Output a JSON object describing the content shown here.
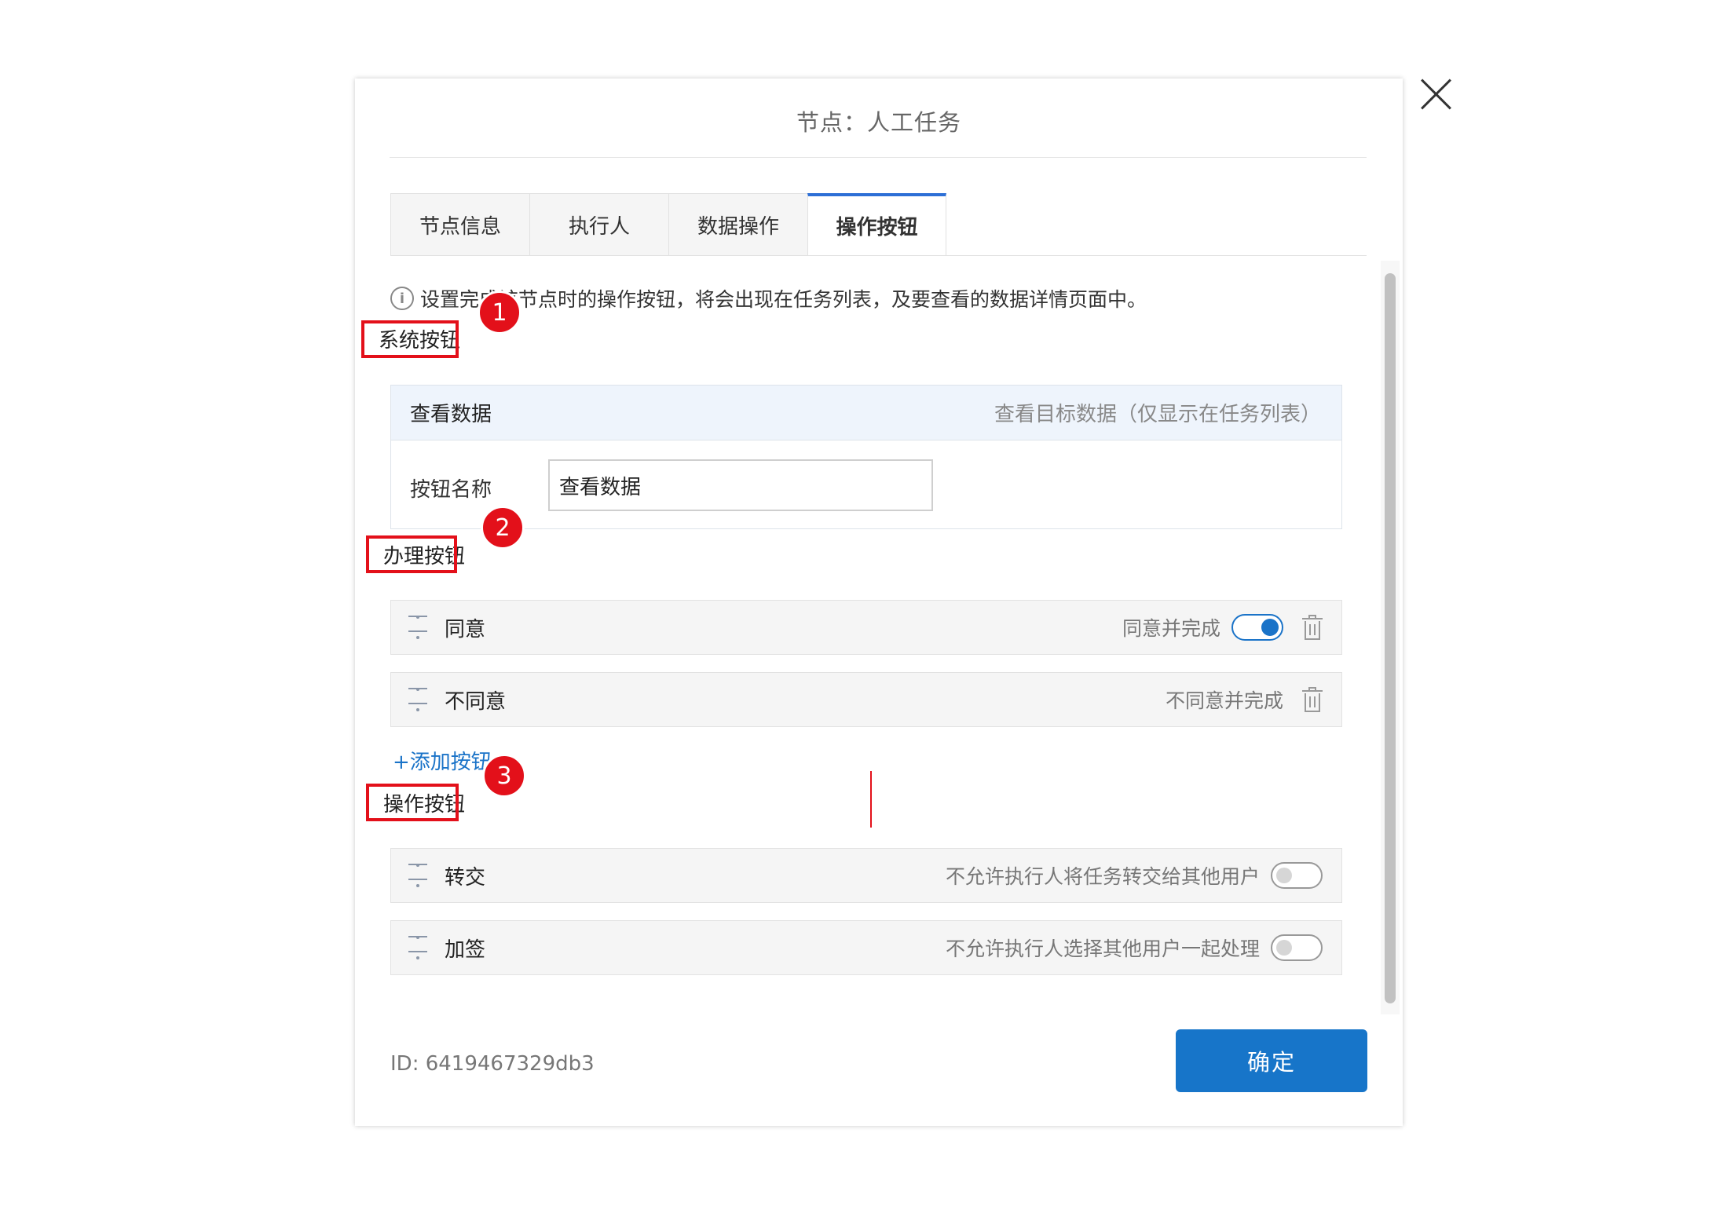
{
  "modal": {
    "title": "节点：人工任务",
    "tabs": [
      {
        "label": "节点信息"
      },
      {
        "label": "执行人"
      },
      {
        "label": "数据操作"
      },
      {
        "label": "操作按钮"
      }
    ],
    "active_tab": "操作按钮",
    "info_text": "设置完成该节点时的操作按钮，将会出现在任务列表，及要查看的数据详情页面中。",
    "info_icon": "info-circle-icon"
  },
  "annotations": [
    "1",
    "2",
    "3"
  ],
  "system_buttons": {
    "section_label": "系统按钮",
    "card": {
      "name": "查看数据",
      "description": "查看目标数据（仅显示在任务列表）",
      "field_label": "按钮名称",
      "field_value": "查看数据"
    }
  },
  "handle_buttons": {
    "section_label": "办理按钮",
    "rows": [
      {
        "name": "同意",
        "description": "同意并完成",
        "toggle": "on"
      },
      {
        "name": "不同意",
        "description": "不同意并完成"
      }
    ],
    "add_label": "+添加按钮"
  },
  "action_buttons": {
    "section_label": "操作按钮",
    "rows": [
      {
        "name": "转交",
        "description": "不允许执行人将任务转交给其他用户",
        "toggle": "off"
      },
      {
        "name": "加签",
        "description": "不允许执行人选择其他用户一起处理",
        "toggle": "off"
      }
    ]
  },
  "footer": {
    "id_text": "ID: 6419467329db3",
    "confirm_label": "确定"
  },
  "colors": {
    "accent": "#1775c9",
    "annotation": "#e3101a",
    "tab_active_border": "#2d6fd6"
  }
}
